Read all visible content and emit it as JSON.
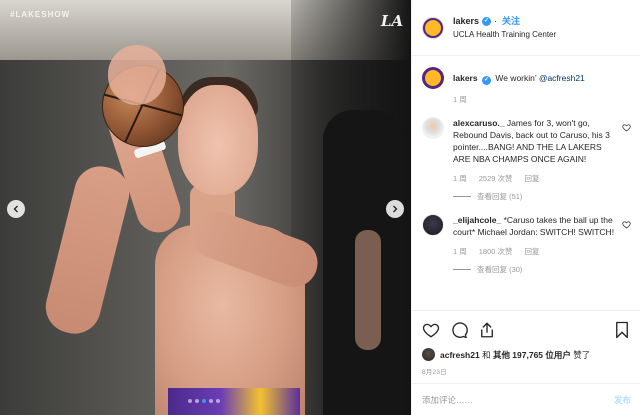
{
  "media": {
    "watermark": "#LAKESHOW",
    "logo_text": "LA",
    "carousel_dots": 5,
    "active_dot": 3
  },
  "header": {
    "username": "lakers",
    "follow_label": "关注",
    "location": "UCLA Health Training Center"
  },
  "caption": {
    "username": "lakers",
    "text": "We workin’ ",
    "mention": "@acfresh21",
    "time": "1 周"
  },
  "comments": [
    {
      "username": "alexcaruso._",
      "text": " James for 3, won't go, Rebound Davis, back out to Caruso, his 3 pointer....BANG! AND THE LA LAKERS ARE NBA CHAMPS ONCE AGAIN!",
      "time": "1 周",
      "likes": "2529 次赞",
      "reply_label": "回复",
      "view_replies": "查看回复 (51)"
    },
    {
      "username": "_elijahcole_",
      "text": " *Caruso takes the ball up the court* Michael Jordan: SWITCH! SWITCH!",
      "time": "1 周",
      "likes": "1800 次赞",
      "reply_label": "回复",
      "view_replies": "查看回复 (30)"
    }
  ],
  "likes_line": {
    "user": "acfresh21",
    "joiner": " 和 ",
    "others": "其他 197,765 位用户",
    "suffix": " 赞了"
  },
  "date": "8月23日",
  "add_comment": {
    "placeholder": "添加评论……",
    "post_label": "发布"
  },
  "colors": {
    "accent_blue": "#3897f0",
    "lakers_purple": "#542582",
    "lakers_gold": "#fdb927",
    "muted": "#999999"
  },
  "icons": [
    "chevron-left-icon",
    "chevron-right-icon",
    "verified-icon",
    "heart-icon",
    "comment-icon",
    "share-icon",
    "bookmark-icon"
  ]
}
